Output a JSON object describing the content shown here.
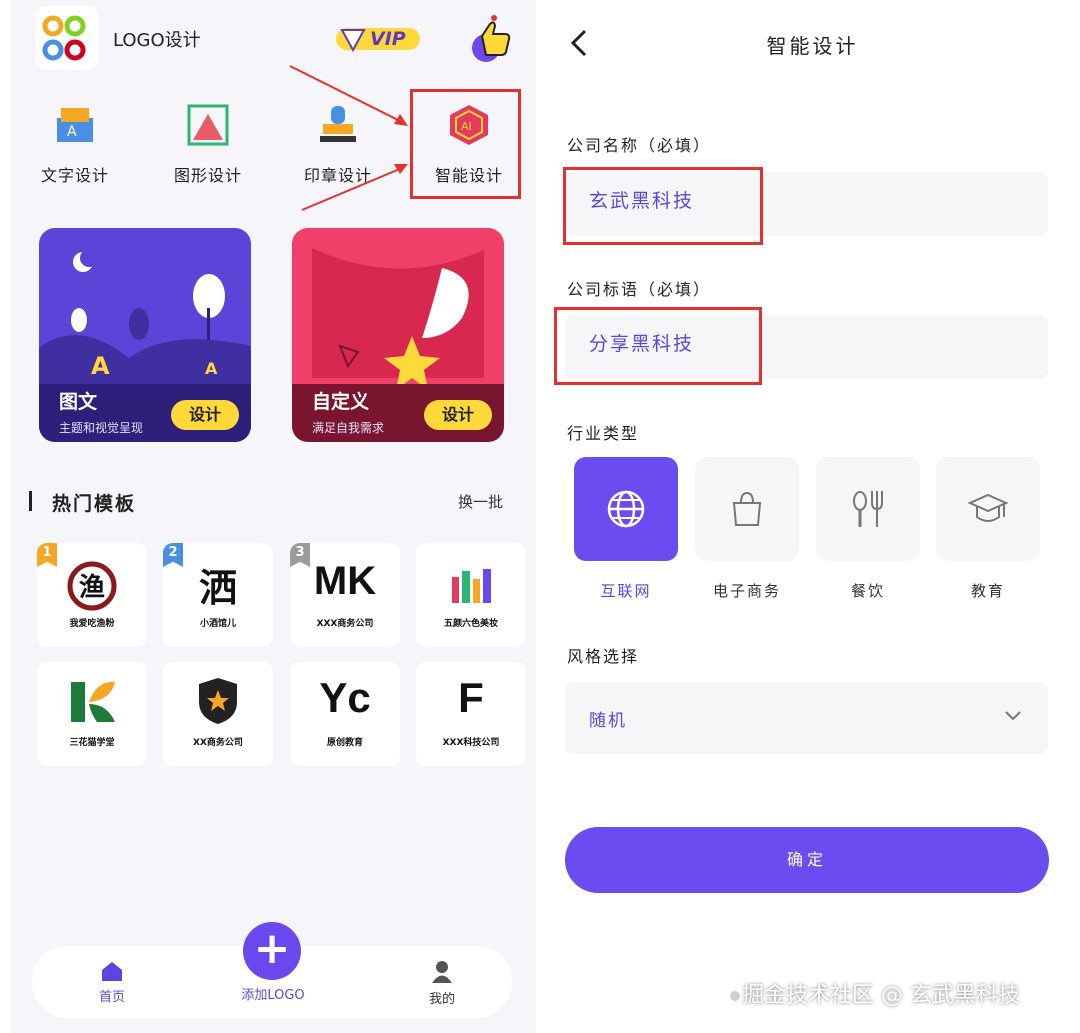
{
  "left": {
    "header": {
      "app_title": "LOGO设计",
      "vip_label": "VIP"
    },
    "menu": [
      {
        "label": "文字设计",
        "icon": "text-design-icon"
      },
      {
        "label": "图形设计",
        "icon": "shape-design-icon"
      },
      {
        "label": "印章设计",
        "icon": "stamp-design-icon"
      },
      {
        "label": "智能设计",
        "icon": "ai-design-icon"
      }
    ],
    "cards": [
      {
        "title": "图文",
        "subtitle": "主题和视觉呈现",
        "button": "设计"
      },
      {
        "title": "自定义",
        "subtitle": "满足自我需求",
        "button": "设计"
      }
    ],
    "section": {
      "title": "热门模板",
      "more": "换一批"
    },
    "templates": [
      {
        "rank": "1",
        "rank_color": "#f5a623",
        "mark": "渔",
        "caption": "我爱吃渔粉"
      },
      {
        "rank": "2",
        "rank_color": "#4a90e2",
        "mark": "洒",
        "caption": "小酒馆儿"
      },
      {
        "rank": "3",
        "rank_color": "#9b9b9b",
        "mark": "MK",
        "caption": "XXX商务公司"
      },
      {
        "rank": "",
        "rank_color": "",
        "mark": "",
        "caption": "五颜六色美妆"
      },
      {
        "rank": "",
        "rank_color": "",
        "mark": "",
        "caption": "三花猫学堂"
      },
      {
        "rank": "",
        "rank_color": "",
        "mark": "",
        "caption": "XX商务公司"
      },
      {
        "rank": "",
        "rank_color": "",
        "mark": "Yc",
        "caption": "原创教育"
      },
      {
        "rank": "",
        "rank_color": "",
        "mark": "F",
        "caption": "XXX科技公司"
      }
    ],
    "nav": {
      "home": "首页",
      "add": "添加LOGO",
      "mine": "我的"
    }
  },
  "right": {
    "title": "智能设计",
    "company_name": {
      "label": "公司名称（必填）",
      "value": "玄武黑科技"
    },
    "slogan": {
      "label": "公司标语（必填）",
      "value": "分享黑科技"
    },
    "industry": {
      "label": "行业类型",
      "options": [
        {
          "label": "互联网",
          "icon": "globe-icon",
          "selected": true
        },
        {
          "label": "电子商务",
          "icon": "shopping-bag-icon",
          "selected": false
        },
        {
          "label": "餐饮",
          "icon": "utensils-icon",
          "selected": false
        },
        {
          "label": "教育",
          "icon": "graduation-cap-icon",
          "selected": false
        }
      ]
    },
    "style": {
      "label": "风格选择",
      "value": "随机"
    },
    "confirm": "确定"
  },
  "watermark": "掘金技术社区 @ 玄武黑科技",
  "colors": {
    "accent": "#6a4cf0",
    "highlight_box": "#e53030",
    "card_purple": "#5d44d8",
    "card_pink": "#f04068",
    "button_yellow": "#ffd83a"
  }
}
